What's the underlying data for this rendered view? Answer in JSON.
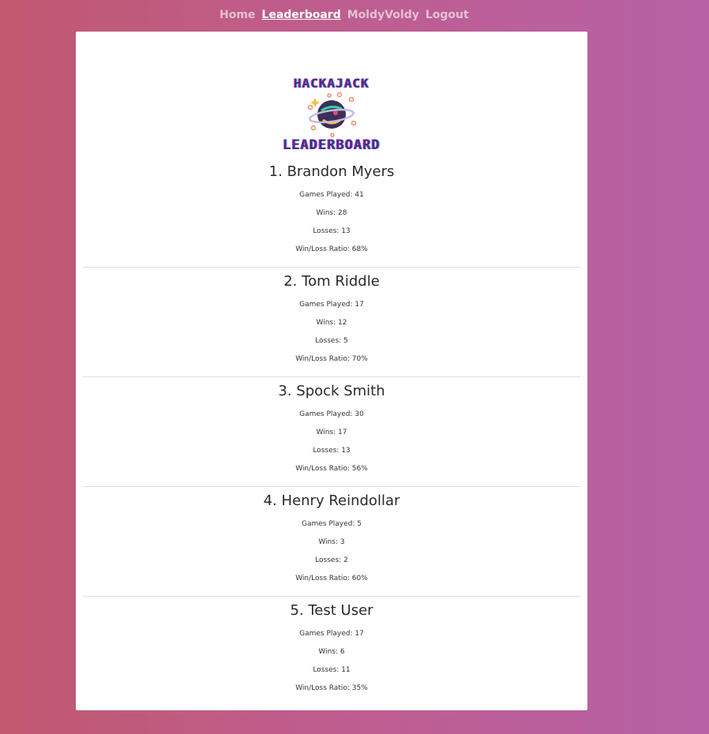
{
  "nav": {
    "items": [
      {
        "label": "Home",
        "active": false
      },
      {
        "label": "Leaderboard",
        "active": true
      },
      {
        "label": "MoldyVoldy",
        "active": false
      },
      {
        "label": "Logout",
        "active": false
      }
    ]
  },
  "logo": {
    "top": "HACKAJACK",
    "bottom": "LEADERBOARD"
  },
  "labels": {
    "games_played": "Games Played:",
    "wins": "Wins:",
    "losses": "Losses:",
    "ratio": "Win/Loss Ratio:"
  },
  "players": [
    {
      "rank": "1.",
      "name": "Brandon Myers",
      "games": "41",
      "wins": "28",
      "losses": "13",
      "ratio": "68%"
    },
    {
      "rank": "2.",
      "name": "Tom Riddle",
      "games": "17",
      "wins": "12",
      "losses": "5",
      "ratio": "70%"
    },
    {
      "rank": "3.",
      "name": "Spock Smith",
      "games": "30",
      "wins": "17",
      "losses": "13",
      "ratio": "56%"
    },
    {
      "rank": "4.",
      "name": "Henry Reindollar",
      "games": "5",
      "wins": "3",
      "losses": "2",
      "ratio": "60%"
    },
    {
      "rank": "5.",
      "name": "Test User",
      "games": "17",
      "wins": "6",
      "losses": "11",
      "ratio": "35%"
    }
  ],
  "colors": {
    "background_left": "#c1586f",
    "background_right": "#b762a6",
    "logo_text": "#4b2a8f",
    "card": "#ffffff"
  }
}
